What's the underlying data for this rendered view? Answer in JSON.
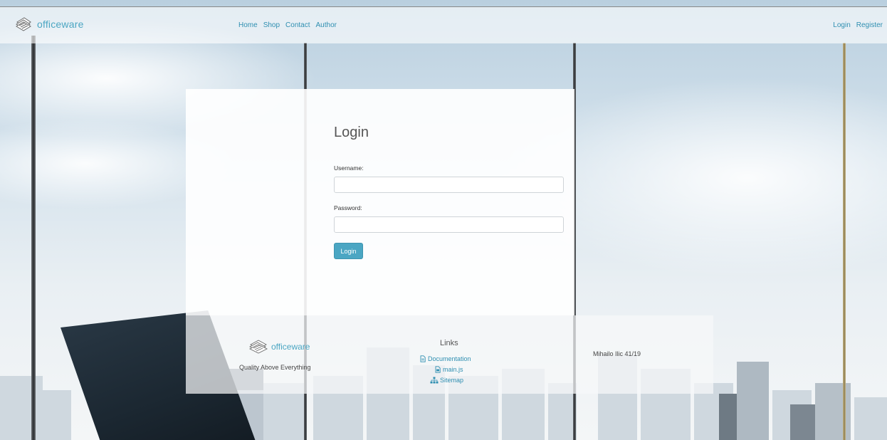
{
  "navbar": {
    "brand": "officeware",
    "links": [
      "Home",
      "Shop",
      "Contact",
      "Author"
    ],
    "right_links": [
      "Login",
      "Register"
    ]
  },
  "login": {
    "title": "Login",
    "username_label": "Username:",
    "username_value": "",
    "password_label": "Password:",
    "password_value": "",
    "submit_label": "Login"
  },
  "footer": {
    "brand": "officeware",
    "tagline": "Quality Above Everything",
    "links_title": "Links",
    "links": [
      {
        "label": "Documentation",
        "icon": "document-icon"
      },
      {
        "label": "main.js",
        "icon": "file-code-icon"
      },
      {
        "label": "Sitemap",
        "icon": "sitemap-icon"
      }
    ],
    "author": "Mihailo Ilic 41/19"
  },
  "colors": {
    "accent": "#4ba6c3",
    "link": "#2f8fb1"
  }
}
